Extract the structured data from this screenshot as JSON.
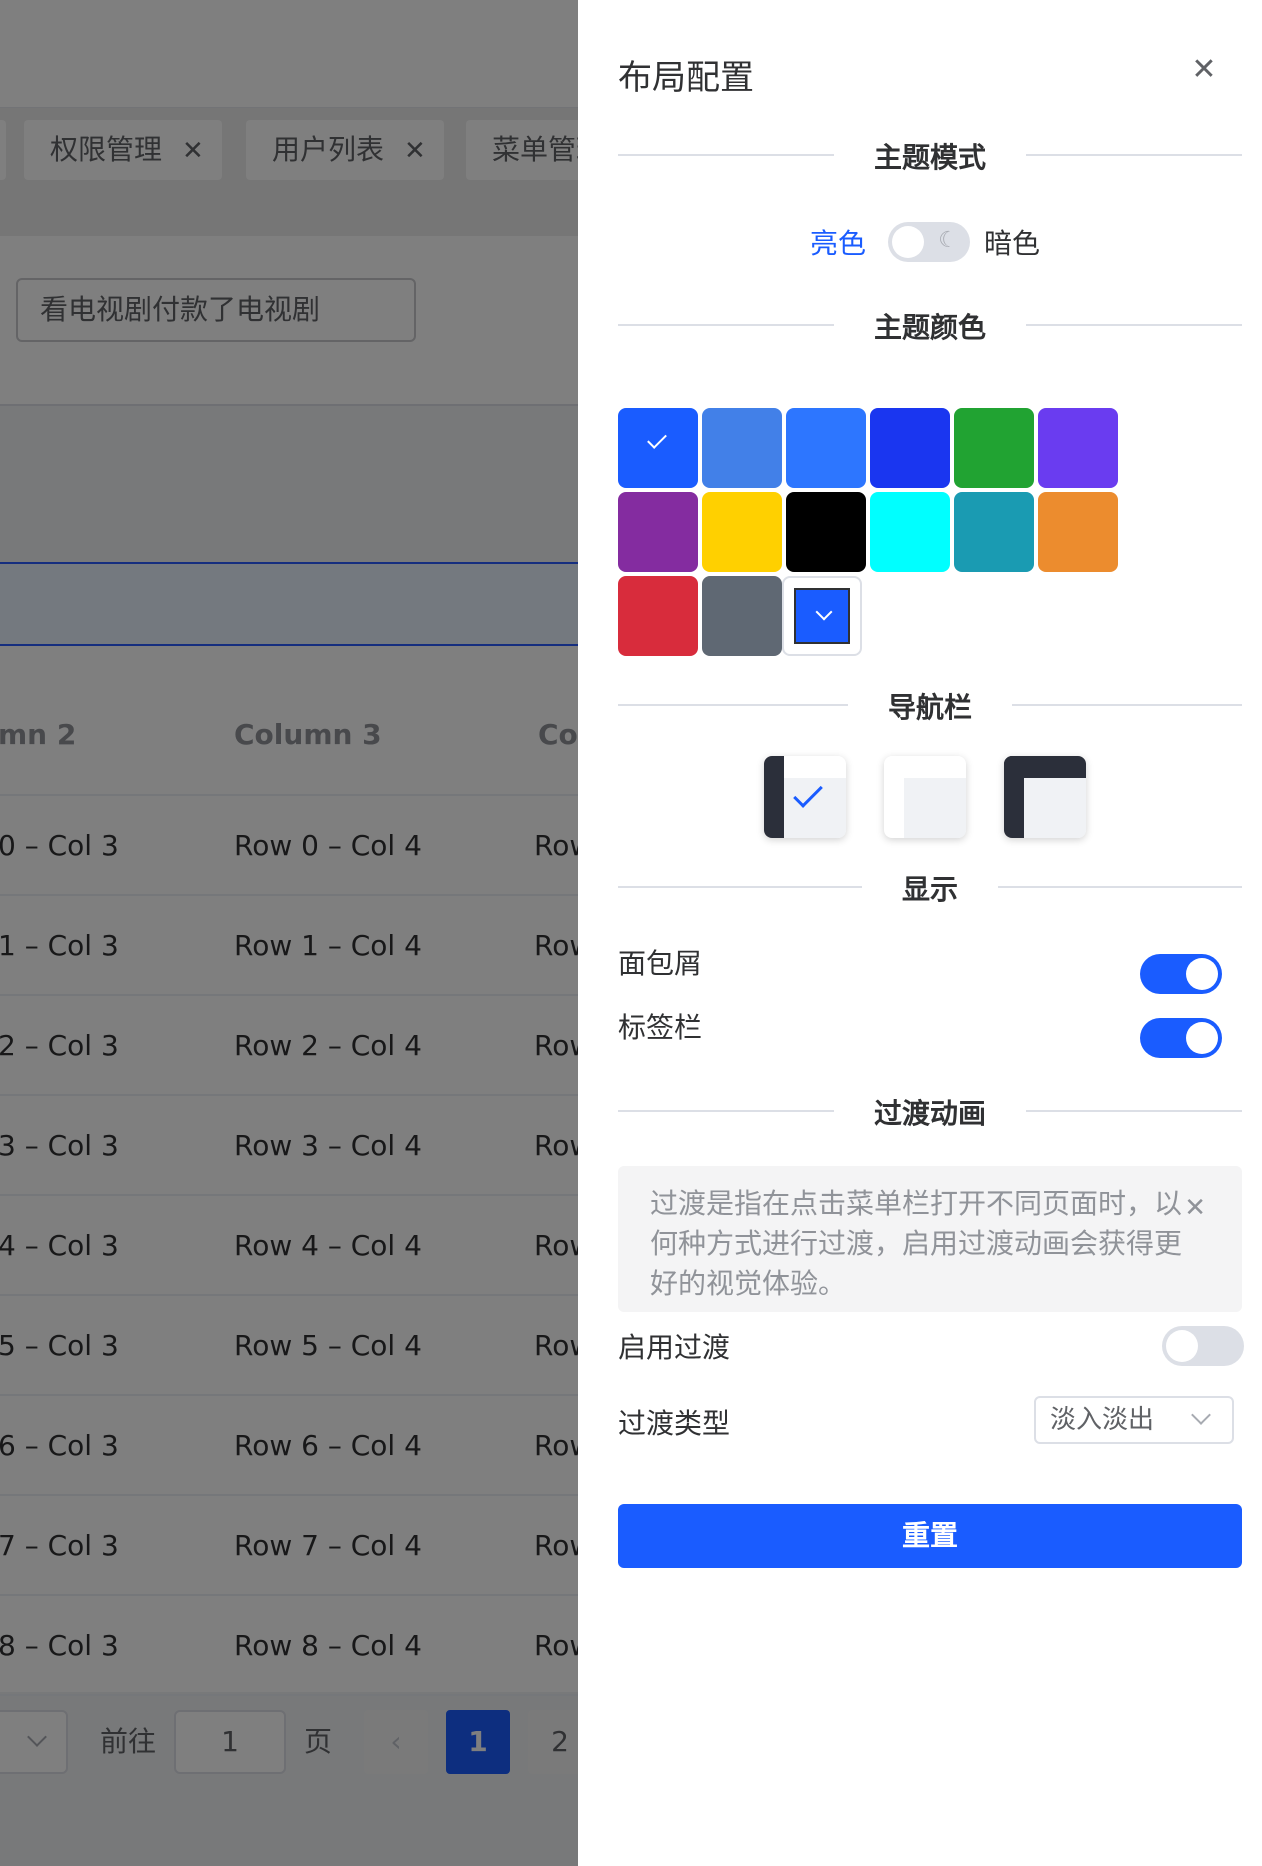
{
  "background": {
    "tabs": [
      {
        "label": "权限管理",
        "close": "✕"
      },
      {
        "label": "用户列表",
        "close": "✕"
      },
      {
        "label": "菜单管理"
      }
    ],
    "search_value": "看电视剧付款了电视剧",
    "table": {
      "headers": [
        "mn 2",
        "Column 3",
        "Col"
      ],
      "rows": [
        [
          "0 – Col 3",
          "Row 0 – Col 4",
          "Row"
        ],
        [
          "1 – Col 3",
          "Row 1 – Col 4",
          "Row"
        ],
        [
          "2 – Col 3",
          "Row 2 – Col 4",
          "Row"
        ],
        [
          "3 – Col 3",
          "Row 3 – Col 4",
          "Row"
        ],
        [
          "4 – Col 3",
          "Row 4 – Col 4",
          "Row"
        ],
        [
          "5 – Col 3",
          "Row 5 – Col 4",
          "Row"
        ],
        [
          "6 – Col 3",
          "Row 6 – Col 4",
          "Row"
        ],
        [
          "7 – Col 3",
          "Row 7 – Col 4",
          "Row"
        ],
        [
          "8 – Col 3",
          "Row 8 – Col 4",
          "Row"
        ]
      ]
    },
    "pagination": {
      "goto_label": "前往",
      "goto_value": "1",
      "page_suffix": "页",
      "prev": "‹",
      "pages": [
        "1",
        "2"
      ]
    }
  },
  "drawer": {
    "title": "布局配置",
    "close": "✕",
    "theme_mode": {
      "heading": "主题模式",
      "light": "亮色",
      "dark": "暗色",
      "moon": "☾"
    },
    "theme_color": {
      "heading": "主题颜色",
      "swatches": [
        "#1a5cff",
        "#4280e8",
        "#2d76ff",
        "#1a36f0",
        "#21a332",
        "#6a3cf0",
        "#842ca0",
        "#ffd000",
        "#000000",
        "#00ffff",
        "#1a9bb2",
        "#ec8c2e",
        "#d82c3c",
        "#5f6873"
      ],
      "selected": "#1a5cff"
    },
    "nav": {
      "heading": "导航栏"
    },
    "display": {
      "heading": "显示",
      "breadcrumb": "面包屑",
      "tagsbar": "标签栏"
    },
    "transition": {
      "heading": "过渡动画",
      "alert": "过渡是指在点击菜单栏打开不同页面时，以何种方式进行过渡，启用过渡动画会获得更好的视觉体验。",
      "alert_close": "✕",
      "enable": "启用过渡",
      "type_label": "过渡类型",
      "type_value": "淡入淡出"
    },
    "reset": "重置"
  }
}
